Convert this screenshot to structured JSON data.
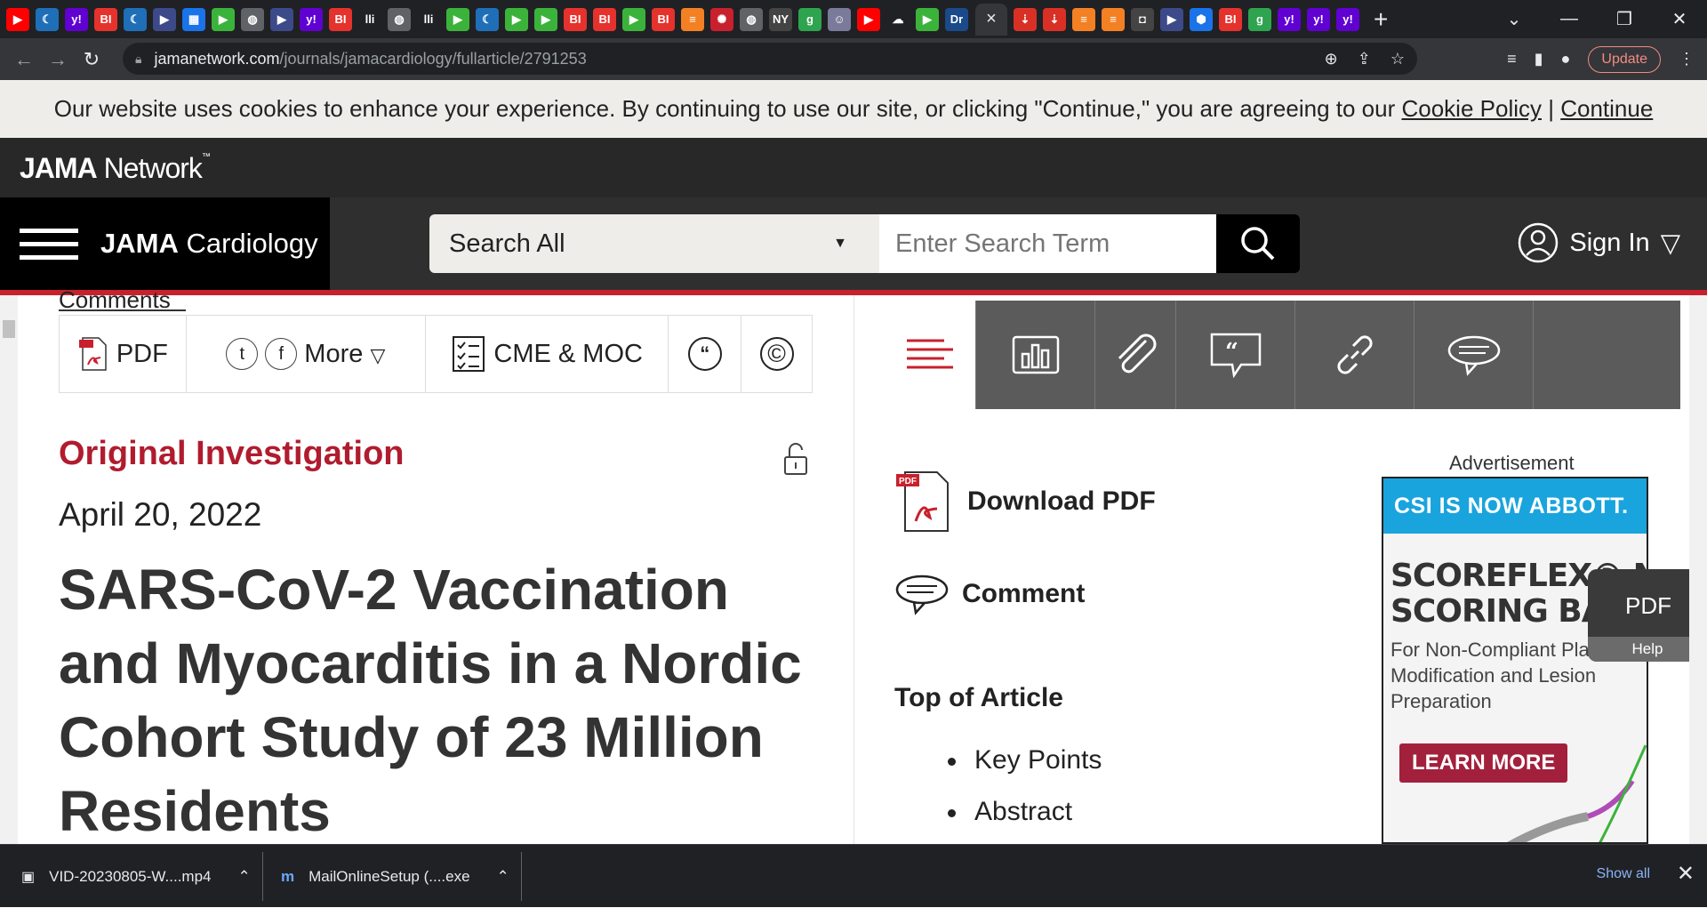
{
  "browser": {
    "tab_icons": [
      {
        "icon": "youtube-icon",
        "color": "#ff0000",
        "glyph": "▶"
      },
      {
        "icon": "shield-icon",
        "color": "#1e6fb8",
        "glyph": "☾"
      },
      {
        "icon": "yahoo-icon",
        "color": "#6001d2",
        "glyph": "y!"
      },
      {
        "icon": "bi-icon",
        "color": "#e5322d",
        "glyph": "BI"
      },
      {
        "icon": "shield-icon",
        "color": "#1e6fb8",
        "glyph": "☾"
      },
      {
        "icon": "flag-icon",
        "color": "#3c4a8a",
        "glyph": "▶"
      },
      {
        "icon": "grid-icon",
        "color": "#1a73e8",
        "glyph": "▦"
      },
      {
        "icon": "play-icon",
        "color": "#3bb33b",
        "glyph": "▶"
      },
      {
        "icon": "globe-icon",
        "color": "#5f6368",
        "glyph": "◍"
      },
      {
        "icon": "flag-icon",
        "color": "#3c4a8a",
        "glyph": "▶"
      },
      {
        "icon": "yahoo-icon",
        "color": "#6001d2",
        "glyph": "y!"
      },
      {
        "icon": "bi-icon",
        "color": "#e5322d",
        "glyph": "BI"
      },
      {
        "icon": "lli-icon",
        "color": "#202124",
        "glyph": "lli"
      },
      {
        "icon": "globe-icon",
        "color": "#5f6368",
        "glyph": "◍"
      },
      {
        "icon": "lli-icon",
        "color": "#202124",
        "glyph": "lli"
      },
      {
        "icon": "play-icon",
        "color": "#3bb33b",
        "glyph": "▶"
      },
      {
        "icon": "shield-icon",
        "color": "#1e6fb8",
        "glyph": "☾"
      },
      {
        "icon": "play-icon",
        "color": "#3bb33b",
        "glyph": "▶"
      },
      {
        "icon": "play-icon",
        "color": "#3bb33b",
        "glyph": "▶"
      },
      {
        "icon": "bi-icon",
        "color": "#e5322d",
        "glyph": "BI"
      },
      {
        "icon": "bi-icon",
        "color": "#e5322d",
        "glyph": "BI"
      },
      {
        "icon": "play-icon",
        "color": "#3bb33b",
        "glyph": "▶"
      },
      {
        "icon": "bi-icon",
        "color": "#e5322d",
        "glyph": "BI"
      },
      {
        "icon": "stack-icon",
        "color": "#f48024",
        "glyph": "≡"
      },
      {
        "icon": "burst-icon",
        "color": "#c8202d",
        "glyph": "✺"
      },
      {
        "icon": "globe-icon",
        "color": "#5f6368",
        "glyph": "◍"
      },
      {
        "icon": "ny-icon",
        "color": "#444444",
        "glyph": "NY"
      },
      {
        "icon": "g-icon",
        "color": "#2ea44f",
        "glyph": "g"
      },
      {
        "icon": "avatar-icon",
        "color": "#7a7a9a",
        "glyph": "☺"
      },
      {
        "icon": "youtube-icon",
        "color": "#ff0000",
        "glyph": "▶"
      },
      {
        "icon": "nbc-icon",
        "color": "#202124",
        "glyph": "☁"
      },
      {
        "icon": "play-icon",
        "color": "#3bb33b",
        "glyph": "▶"
      },
      {
        "icon": "dr-icon",
        "color": "#1a4a8a",
        "glyph": "Dr"
      },
      {
        "icon": "pin-icon",
        "color": "#d93025",
        "glyph": "⇣"
      },
      {
        "icon": "pin-icon",
        "color": "#d93025",
        "glyph": "⇣"
      },
      {
        "icon": "stack-icon",
        "color": "#f48024",
        "glyph": "≡"
      },
      {
        "icon": "stack-icon",
        "color": "#f48024",
        "glyph": "≡"
      },
      {
        "icon": "ap-icon",
        "color": "#444444",
        "glyph": "◘"
      },
      {
        "icon": "flag-icon",
        "color": "#3c4a8a",
        "glyph": "▶"
      },
      {
        "icon": "hex-icon",
        "color": "#1a73e8",
        "glyph": "⬢"
      },
      {
        "icon": "bi-icon",
        "color": "#e5322d",
        "glyph": "BI"
      },
      {
        "icon": "g-icon",
        "color": "#2ea44f",
        "glyph": "g"
      },
      {
        "icon": "yahoo-icon",
        "color": "#6001d2",
        "glyph": "y!"
      },
      {
        "icon": "yahoo-icon",
        "color": "#6001d2",
        "glyph": "y!"
      },
      {
        "icon": "yahoo-icon",
        "color": "#6001d2",
        "glyph": "y!"
      }
    ],
    "active_tab_close": "×",
    "new_tab": "+",
    "url_host": "jamanetwork.com",
    "url_path": "/journals/jamacardiology/fullarticle/2791253",
    "update_label": "Update"
  },
  "cookie_bar": {
    "message": "Our website uses cookies to enhance your experience. By continuing to use our site, or clicking \"Continue,\" you are agreeing to our ",
    "policy_link": "Cookie Policy",
    "separator": " | ",
    "continue_link": "Continue"
  },
  "header": {
    "network_bold": "JAMA",
    "network_rest": " Network",
    "network_tm": "™",
    "journal_bold": "JAMA",
    "journal_rest": " Cardiology",
    "search_scope": "Search All",
    "search_placeholder": "Enter Search Term",
    "sign_in": "Sign In"
  },
  "article": {
    "comments_stub": "Comments",
    "tools": {
      "pdf": "PDF",
      "twitter": "t",
      "facebook": "f",
      "more": "More",
      "cme": "CME & MOC",
      "cite": "“",
      "permissions": "©"
    },
    "type": "Original Investigation",
    "date": "April 20, 2022",
    "title": "SARS-CoV-2 Vaccination and Myocarditis in a Nordic Cohort Study of 23 Million Residents"
  },
  "sidebar": {
    "download_pdf": "Download PDF",
    "comment": "Comment",
    "top_of_article": "Top of Article",
    "toc": [
      "Key Points",
      "Abstract"
    ]
  },
  "ad": {
    "label": "Advertisement",
    "banner": "CSI IS NOW ABBOTT.",
    "headline": "SCOREFLEX® NC\nSCORING BALLOON",
    "subtext": "For Non-Compliant Plaque Modification and Lesion Preparation",
    "cta": "LEARN MORE"
  },
  "pdf_float": {
    "pdf": "PDF",
    "help": "Help"
  },
  "downloads": {
    "items": [
      {
        "name": "VID-20230805-W....mp4"
      },
      {
        "name": "MailOnlineSetup (....exe"
      }
    ],
    "show_all": "Show all"
  },
  "colors": {
    "brand_red": "#b01c2e",
    "accent_line": "#c8202d"
  }
}
